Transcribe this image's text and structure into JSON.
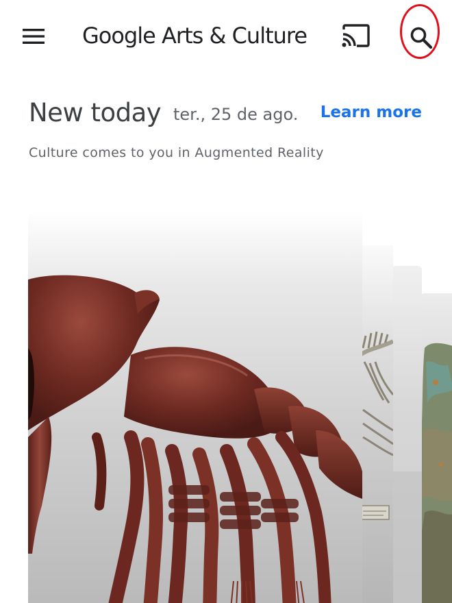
{
  "app": {
    "title": "Google Arts & Culture",
    "icons": {
      "menu": "menu-icon",
      "cast": "cast-icon",
      "search": "search-icon"
    },
    "colors": {
      "accent": "#1a73e8",
      "highlight_ring": "#e0101b",
      "text_primary": "#202124",
      "text_secondary": "#5f6368"
    }
  },
  "section": {
    "title": "New today",
    "date": "ter., 25 de ago.",
    "learn_more": "Learn more",
    "subtitle": "Culture comes to you in Augmented Reality"
  },
  "carousel": {
    "cards": [
      {
        "subject": "red crustacean-like fossil creature 3D model"
      },
      {
        "subject": "skeleton"
      },
      {
        "subject": "artifact"
      },
      {
        "subject": "green fossil"
      }
    ]
  }
}
